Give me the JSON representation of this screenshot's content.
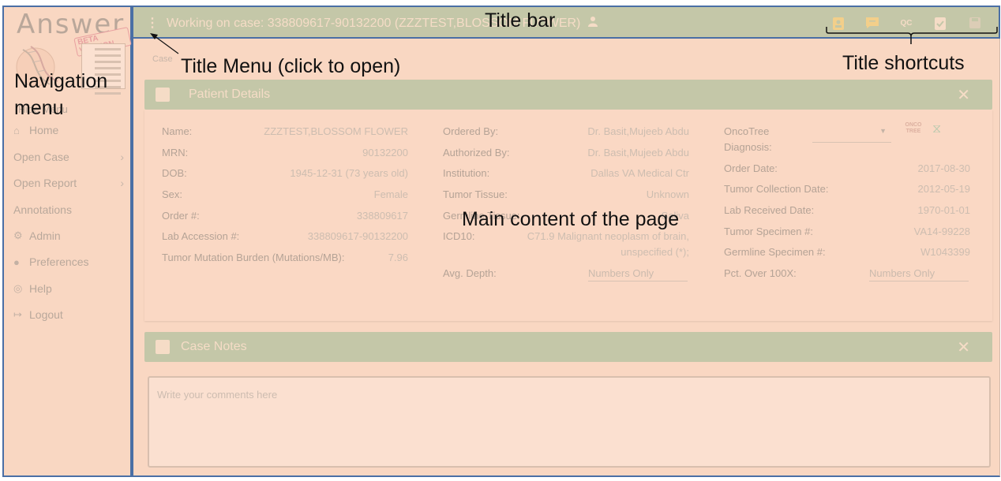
{
  "sidebar": {
    "logo_word": "Answer",
    "beta_label": "BETA VERSION",
    "hide_menu": "Hide Menu",
    "items": [
      {
        "label": "Home",
        "icon": "home-icon",
        "glyph": "⌂",
        "has_chevron": false
      },
      {
        "label": "Open Case",
        "icon": "",
        "glyph": "",
        "has_chevron": true
      },
      {
        "label": "Open Report",
        "icon": "",
        "glyph": "",
        "has_chevron": true
      },
      {
        "label": "Annotations",
        "icon": "",
        "glyph": "",
        "has_chevron": false
      },
      {
        "label": "Admin",
        "icon": "gear-icon",
        "glyph": "⚙",
        "has_chevron": false
      },
      {
        "label": "Preferences",
        "icon": "user-circle-icon",
        "glyph": "●",
        "has_chevron": false
      },
      {
        "label": "Help",
        "icon": "lifebuoy-icon",
        "glyph": "◎",
        "has_chevron": false
      },
      {
        "label": "Logout",
        "icon": "logout-icon",
        "glyph": "↦",
        "has_chevron": false
      }
    ]
  },
  "titlebar": {
    "text": "Working on case: 338809617-90132200 (ZZZTEST,BLOSSOM FLOWER)",
    "shortcuts": [
      {
        "name": "patient-details-shortcut",
        "icon": "id-badge-icon"
      },
      {
        "name": "case-notes-shortcut",
        "icon": "comment-icon"
      },
      {
        "name": "qc-shortcut",
        "label": "QC"
      },
      {
        "name": "review-shortcut",
        "icon": "clipboard-check-icon"
      },
      {
        "name": "save-shortcut",
        "icon": "save-icon"
      }
    ]
  },
  "main": {
    "breadcrumb": "Case",
    "patient_details": {
      "title": "Patient Details",
      "col1": [
        {
          "label": "Name:",
          "value": "ZZZTEST,BLOSSOM FLOWER"
        },
        {
          "label": "MRN:",
          "value": "90132200"
        },
        {
          "label": "DOB:",
          "value": "1945-12-31 (73 years old)"
        },
        {
          "label": "Sex:",
          "value": "Female"
        },
        {
          "label": "Order #:",
          "value": "338809617"
        },
        {
          "label": "Lab Accession #:",
          "value": "338809617-90132200"
        },
        {
          "label": "Tumor Mutation Burden (Mutations/MB):",
          "value": "7.96"
        }
      ],
      "col2": [
        {
          "label": "Ordered By:",
          "value": "Dr. Basit,Mujeeb Abdu"
        },
        {
          "label": "Authorized By:",
          "value": "Dr. Basit,Mujeeb Abdu"
        },
        {
          "label": "Institution:",
          "value": "Dallas VA Medical Ctr"
        },
        {
          "label": "Tumor Tissue:",
          "value": "Unknown"
        },
        {
          "label": "Germline Tissue:",
          "value": "Saliva"
        },
        {
          "label": "ICD10:",
          "value": "C71.9 Malignant neoplasm of brain,",
          "value2": "unspecified (*);"
        }
      ],
      "avg_depth_label": "Avg. Depth:",
      "avg_depth_placeholder": "Numbers Only",
      "col3": {
        "oncotree_label_1": "OncoTree",
        "oncotree_label_2": "Diagnosis:",
        "oncotree_badge": "ONCO TREE",
        "rows": [
          {
            "label": "Order Date:",
            "value": "2017-08-30"
          },
          {
            "label": "Tumor Collection Date:",
            "value": "2012-05-19"
          },
          {
            "label": "Lab Received Date:",
            "value": "1970-01-01"
          },
          {
            "label": "Tumor Specimen #:",
            "value": "VA14-99228"
          },
          {
            "label": "Germline Specimen #:",
            "value": "W1043399"
          }
        ],
        "pct_label": "Pct. Over 100X:",
        "pct_placeholder": "Numbers Only"
      },
      "close": "✕"
    },
    "case_notes": {
      "title": "Case Notes",
      "placeholder": "Write your comments here",
      "close": "✕"
    }
  },
  "annotations": {
    "title_bar": "Title bar",
    "title_menu": "Title Menu (click to open)",
    "navigation_line1": "Navigation",
    "navigation_line2": "menu",
    "title_shortcuts": "Title shortcuts",
    "main_content": "Main content of the page"
  },
  "colors": {
    "page_overlay": "#f9d7c2",
    "header_green": "#c4c7a8",
    "highlight_border": "#4a6fa5"
  }
}
